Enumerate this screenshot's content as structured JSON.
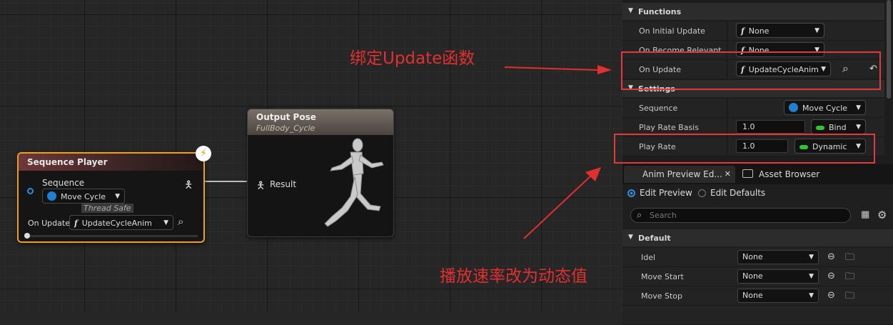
{
  "graph": {
    "sequence_player": {
      "title": "Sequence Player",
      "sequence_label": "Sequence",
      "sequence_value": "Move Cycle",
      "thread_safe": "Thread Safe",
      "on_update_label": "On Update",
      "on_update_value": "UpdateCycleAnim"
    },
    "output_pose": {
      "title": "Output Pose",
      "subtitle": "FullBody_Cycle",
      "result_label": "Result"
    }
  },
  "details": {
    "functions_header": "Functions",
    "on_initial_update": {
      "label": "On Initial Update",
      "value": "None"
    },
    "on_become_relevant": {
      "label": "On Become Relevant",
      "value": "None"
    },
    "on_update": {
      "label": "On Update",
      "value": "UpdateCycleAnim"
    },
    "settings_header": "Settings",
    "sequence": {
      "label": "Sequence",
      "value": "Move Cycle"
    },
    "play_rate_basis": {
      "label": "Play Rate Basis",
      "value": "1.0",
      "bind": "Bind"
    },
    "play_rate": {
      "label": "Play Rate",
      "value": "1.0",
      "bind": "Dynamic"
    }
  },
  "preview": {
    "tab_anim_preview": "Anim Preview Ed...",
    "tab_asset_browser": "Asset Browser",
    "edit_preview": "Edit Preview",
    "edit_defaults": "Edit Defaults",
    "search_placeholder": "Search",
    "default_header": "Default",
    "rows": [
      {
        "label": "Idel",
        "value": "None"
      },
      {
        "label": "Move Start",
        "value": "None"
      },
      {
        "label": "Move Stop",
        "value": "None"
      }
    ]
  },
  "annotations": {
    "bind_update": "绑定Update函数",
    "dynamic_rate": "播放速率改为动态值"
  },
  "colors": {
    "accent": "#2a8ee0",
    "selection": "#f0a010",
    "annotation": "#e03030",
    "bind_green": "#2ec52e"
  }
}
